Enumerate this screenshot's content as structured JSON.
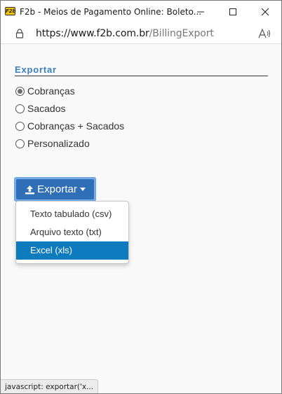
{
  "window": {
    "title": "F2b - Meios de Pagamento Online: Boleto...",
    "app_icon_text": "F2b"
  },
  "address": {
    "host": "https://www.f2b.com.br",
    "path": "/BillingExport"
  },
  "form": {
    "legend": "Exportar",
    "options": [
      {
        "label": "Cobranças",
        "checked": true
      },
      {
        "label": "Sacados",
        "checked": false
      },
      {
        "label": "Cobranças + Sacados",
        "checked": false
      },
      {
        "label": "Personalizado",
        "checked": false
      }
    ]
  },
  "export": {
    "button_label": "Exportar",
    "menu": [
      {
        "label": "Texto tabulado (csv)",
        "active": false
      },
      {
        "label": "Arquivo texto (txt)",
        "active": false
      },
      {
        "label": "Excel (xls)",
        "active": true
      }
    ]
  },
  "status": {
    "text": "javascript: exportar('x..."
  },
  "colors": {
    "legend": "#3a7fbf",
    "button": "#2f6fb5",
    "menu_active": "#0f7bbf"
  }
}
